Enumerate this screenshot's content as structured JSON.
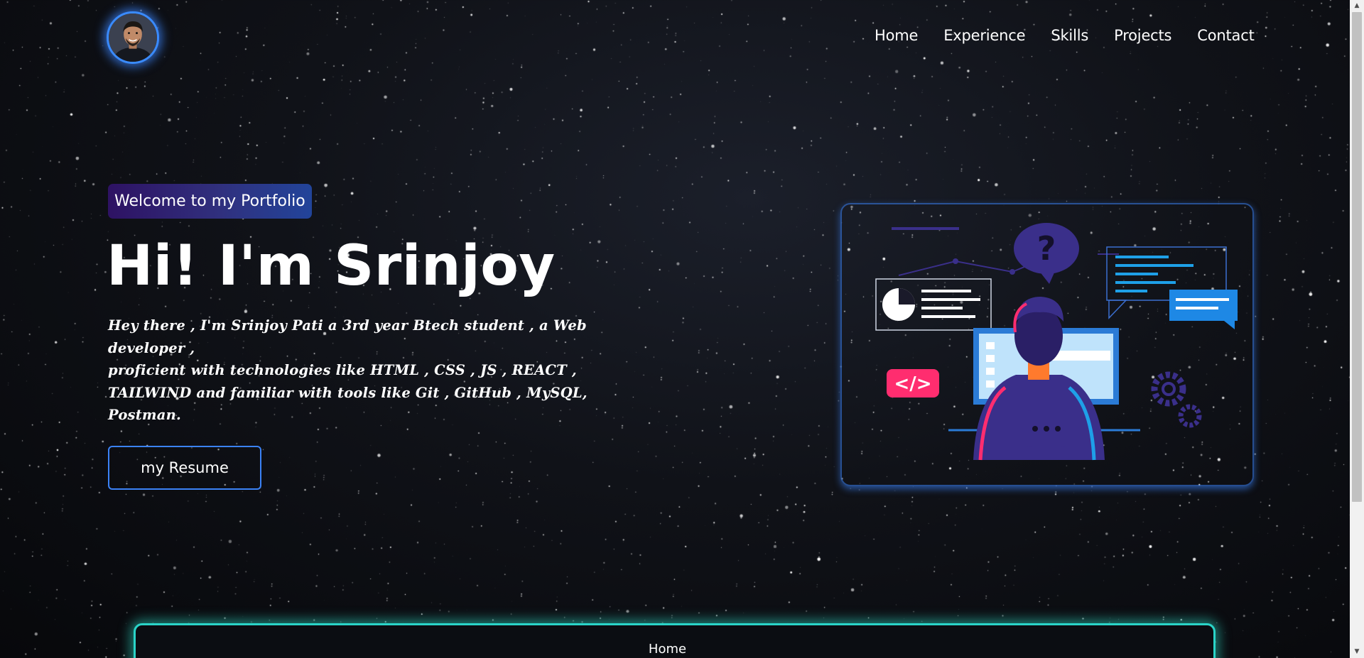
{
  "nav": {
    "items": [
      "Home",
      "Experience",
      "Skills",
      "Projects",
      "Contact"
    ]
  },
  "hero": {
    "badge": "Welcome to my Portfolio",
    "title": "Hi! I'm Srinjoy",
    "description": [
      "Hey there , I'm Srinjoy Pati a 3rd year Btech student , a Web developer ,",
      "proficient with technologies like HTML , CSS , JS , REACT , TAILWIND and familiar with tools like Git , GitHub , MySQL, Postman."
    ],
    "resume_button": "my Resume",
    "illustration_code_tag": "</>"
  },
  "bottom_card": {
    "label": "Home"
  },
  "icons": {
    "avatar": "profile-photo",
    "question": "question-mark-icon",
    "chat": "chat-bubble-icon",
    "gear": "gear-icon",
    "chart": "pie-chart-icon"
  },
  "colors": {
    "accent_blue": "#3b82f6",
    "teal_glow": "#2ad4c8",
    "badge_gradient_start": "#2e1263",
    "badge_gradient_end": "#22449a",
    "code_tag": "#ff2d6f"
  }
}
